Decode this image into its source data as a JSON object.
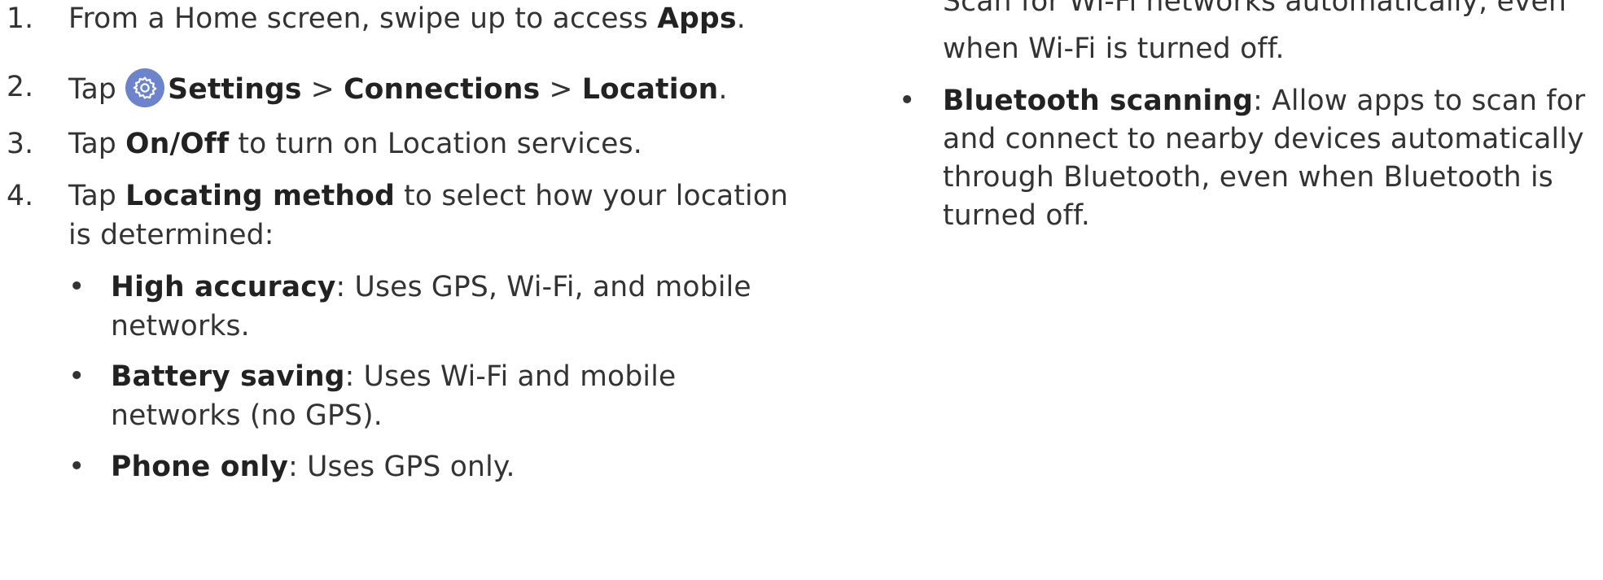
{
  "left_steps": [
    {
      "num": "1.",
      "pre": "From a Home screen, swipe up to access ",
      "bold": "Apps",
      "post": "."
    },
    {
      "num": "2.",
      "pre": "Tap ",
      "b1": "Settings",
      "sep1": " > ",
      "b2": "Connections",
      "sep2": " > ",
      "b3": "Location",
      "post": "."
    },
    {
      "num": "3.",
      "pre": "Tap ",
      "bold": "On/Off",
      "post": " to turn on Location services."
    },
    {
      "num": "4.",
      "pre": "Tap ",
      "bold": "Locating method",
      "post": " to select how your location",
      "line2": "is determined:"
    }
  ],
  "locating_options": [
    {
      "bullet": "•",
      "bold": "High accuracy",
      "post": ": Uses GPS, Wi-Fi, and mobile",
      "line2": "networks."
    },
    {
      "bullet": "•",
      "bold": "Battery saving",
      "post": ": Uses Wi-Fi and mobile",
      "line2": "networks (no GPS)."
    },
    {
      "bullet": "•",
      "bold": "Phone only",
      "post": ": Uses GPS only."
    }
  ],
  "right_column": {
    "clipped_line": "Scan for Wi-Fi networks automatically, even",
    "line_after_clip": "when Wi-Fi is turned off.",
    "bluetooth": {
      "bullet": "•",
      "bold": "Bluetooth scanning",
      "line1_post": ": Allow apps to scan for",
      "line2": "and connect to nearby devices automatically",
      "line3": "through Bluetooth, even when Bluetooth is",
      "line4": "turned off."
    }
  },
  "icons": {
    "settings": "gear-icon"
  },
  "colors": {
    "icon_bg": "#6b84cc",
    "text": "#333333"
  }
}
